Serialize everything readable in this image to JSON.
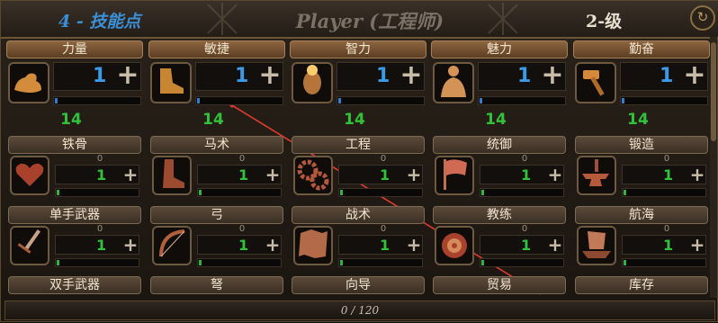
{
  "header": {
    "points": "4 - 技能点",
    "title": "Player (工程师)",
    "level": "2-级"
  },
  "attributes": [
    {
      "label": "力量",
      "value": "1",
      "total": "14",
      "icon": "arm-icon"
    },
    {
      "label": "敏捷",
      "value": "1",
      "total": "14",
      "icon": "boot-icon"
    },
    {
      "label": "智力",
      "value": "1",
      "total": "14",
      "icon": "head-icon"
    },
    {
      "label": "魅力",
      "value": "1",
      "total": "14",
      "icon": "torso-icon"
    },
    {
      "label": "勤奋",
      "value": "1",
      "total": "14",
      "icon": "hammer-icon"
    }
  ],
  "skills_row1": [
    {
      "label": "铁骨",
      "value": "1",
      "base": "0",
      "icon": "heart-icon"
    },
    {
      "label": "马术",
      "value": "1",
      "base": "0",
      "icon": "riding-boot-icon"
    },
    {
      "label": "工程",
      "value": "1",
      "base": "0",
      "icon": "gears-icon"
    },
    {
      "label": "统御",
      "value": "1",
      "base": "0",
      "icon": "flag-icon"
    },
    {
      "label": "锻造",
      "value": "1",
      "base": "0",
      "icon": "anvil-icon"
    }
  ],
  "skills_row2": [
    {
      "label": "单手武器",
      "value": "1",
      "base": "0",
      "icon": "sword-icon"
    },
    {
      "label": "弓",
      "value": "1",
      "base": "0",
      "icon": "bow-icon"
    },
    {
      "label": "战术",
      "value": "1",
      "base": "0",
      "icon": "map-icon"
    },
    {
      "label": "教练",
      "value": "1",
      "base": "0",
      "icon": "target-icon"
    },
    {
      "label": "航海",
      "value": "1",
      "base": "0",
      "icon": "ship-icon"
    }
  ],
  "skills_row3": [
    {
      "label": "双手武器"
    },
    {
      "label": "弩"
    },
    {
      "label": "向导"
    },
    {
      "label": "贸易"
    },
    {
      "label": "库存"
    }
  ],
  "footer": {
    "progress_text": "0 / 120"
  },
  "colors": {
    "accent_blue": "#3b9be8",
    "green": "#31c13a",
    "tab_brown": "#8d6540"
  }
}
